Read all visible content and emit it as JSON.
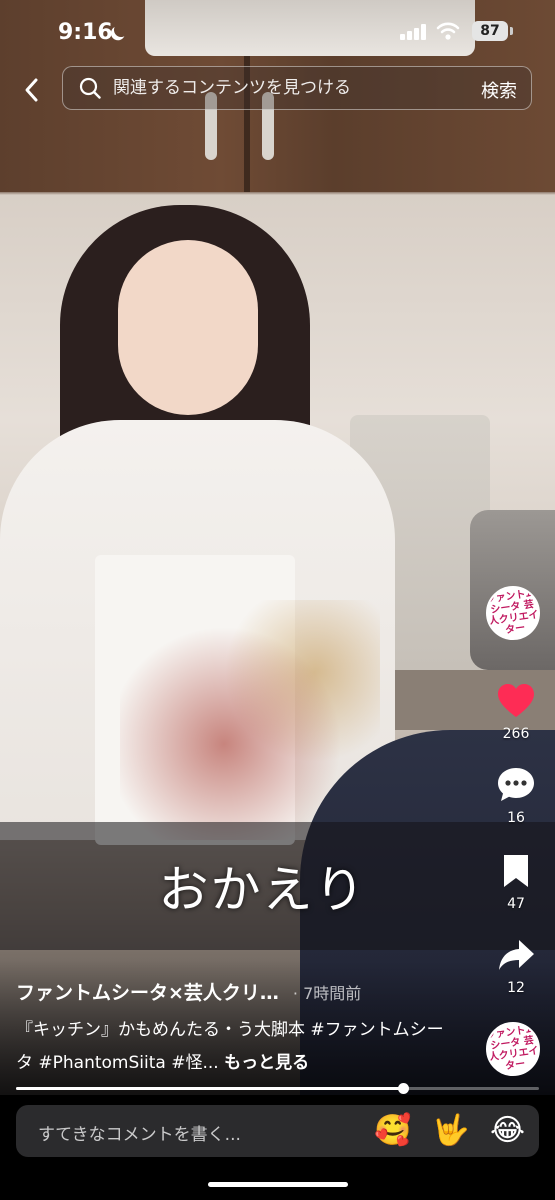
{
  "status_bar": {
    "time": "9:16",
    "battery": "87"
  },
  "search": {
    "placeholder": "関連するコンテンツを見つける",
    "button_label": "検索"
  },
  "video": {
    "subtitle": "おかえり",
    "progress": 0.74
  },
  "rail": {
    "likes": "266",
    "comments": "16",
    "saves": "47",
    "shares": "12",
    "avatar_text": "ファントムシータ 芸人クリエイター",
    "like_color": "#fe2c55"
  },
  "caption": {
    "author": "ファントムシータ×芸人クリ…",
    "time": "· 7時間前",
    "description": "『キッチン』かもめんたる・う大脚本 #ファントムシータ #PhantomSiita #怪...",
    "more": "もっと見る"
  },
  "comment_bar": {
    "placeholder": "すてきなコメントを書く...",
    "emojis": [
      "🥰",
      "🤟",
      "😂"
    ]
  }
}
